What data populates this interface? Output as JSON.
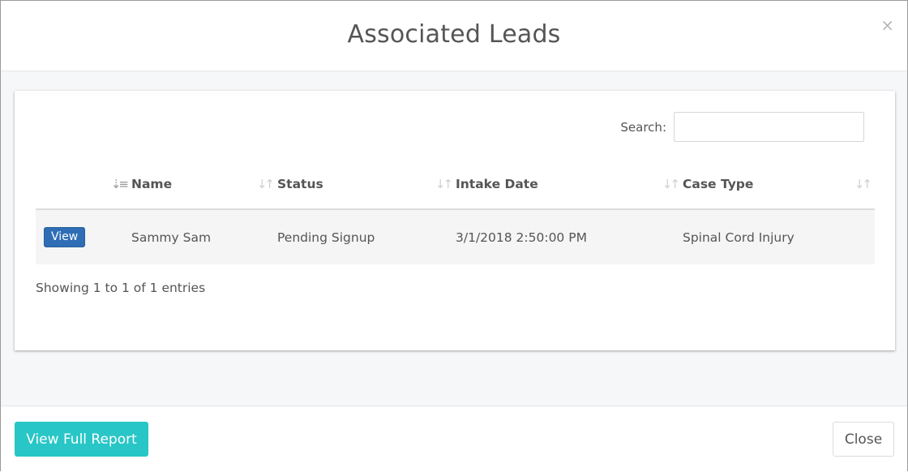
{
  "modal": {
    "title": "Associated Leads",
    "close_icon_glyph": "×"
  },
  "search": {
    "label": "Search:",
    "value": "",
    "placeholder": ""
  },
  "table": {
    "columns": [
      {
        "key": "action",
        "label": ""
      },
      {
        "key": "name",
        "label": "Name"
      },
      {
        "key": "status",
        "label": "Status"
      },
      {
        "key": "intake_date",
        "label": "Intake Date"
      },
      {
        "key": "case_type",
        "label": "Case Type"
      }
    ],
    "sort_icons": {
      "active": "sort-amount-down-icon",
      "inactive": "sort-icon"
    },
    "rows": [
      {
        "action_label": "View",
        "name": "Sammy Sam",
        "status": "Pending Signup",
        "intake_date": "3/1/2018 2:50:00 PM",
        "case_type": "Spinal Cord Injury"
      }
    ],
    "info": "Showing 1 to 1 of 1 entries"
  },
  "footer": {
    "report_button": "View Full Report",
    "close_button": "Close"
  },
  "colors": {
    "report_button_bg": "#28c6c6",
    "view_button_bg": "#2f6eb5",
    "body_bg": "#f6f7f9"
  }
}
